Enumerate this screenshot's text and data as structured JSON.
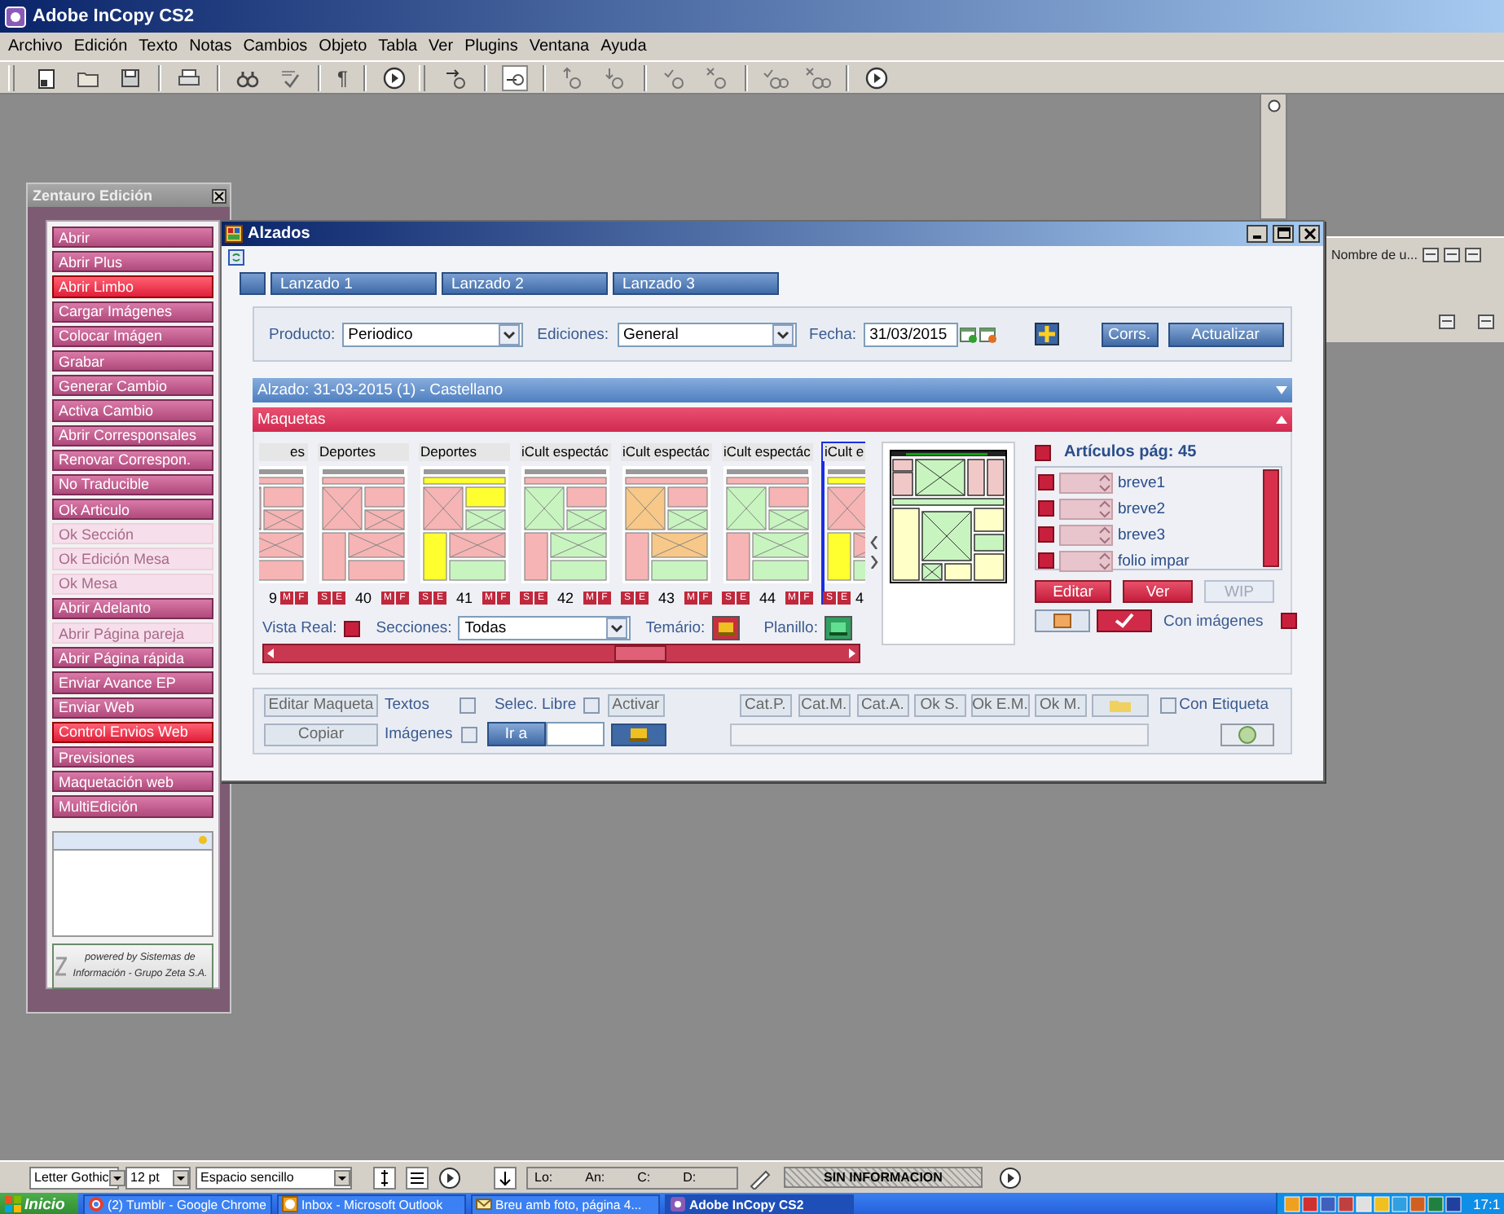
{
  "app": {
    "title": "Adobe InCopy CS2"
  },
  "menu": [
    "Archivo",
    "Edición",
    "Texto",
    "Notas",
    "Cambios",
    "Objeto",
    "Tabla",
    "Ver",
    "Plugins",
    "Ventana",
    "Ayuda"
  ],
  "toolbars": [
    {
      "groups": [
        [
          {
            "kind": "new"
          },
          {
            "kind": "open"
          },
          {
            "kind": "save"
          }
        ],
        [
          {
            "kind": "print"
          }
        ],
        [
          {
            "kind": "find"
          },
          {
            "kind": "spell"
          }
        ],
        [
          {
            "kind": "pilcrow",
            "label": "¶"
          }
        ],
        [
          {
            "kind": "play"
          }
        ]
      ]
    },
    {
      "groups": [
        [
          {
            "kind": "track"
          }
        ],
        [
          {
            "kind": "track-box"
          }
        ],
        [
          {
            "kind": "prev"
          },
          {
            "kind": "next"
          }
        ],
        [
          {
            "kind": "accept"
          },
          {
            "kind": "reject"
          }
        ],
        [
          {
            "kind": "accept-all"
          },
          {
            "kind": "reject-all"
          }
        ],
        [
          {
            "kind": "play"
          }
        ]
      ]
    }
  ],
  "sidepanel": {
    "title": "Zentauro Edición",
    "buttons": [
      {
        "label": "Abrir",
        "highlighted": false,
        "disabled": false
      },
      {
        "label": "Abrir Plus",
        "highlighted": false,
        "disabled": false
      },
      {
        "label": "Abrir Limbo",
        "highlighted": true,
        "disabled": false
      },
      {
        "label": "Cargar Imágenes",
        "highlighted": false,
        "disabled": false
      },
      {
        "label": "Colocar Imágen",
        "highlighted": false,
        "disabled": false
      },
      {
        "label": "Grabar",
        "highlighted": false,
        "disabled": false
      },
      {
        "label": "Generar Cambio",
        "highlighted": false,
        "disabled": false
      },
      {
        "label": "Activa Cambio",
        "highlighted": false,
        "disabled": false
      },
      {
        "label": "Abrir Corresponsales",
        "highlighted": false,
        "disabled": false
      },
      {
        "label": "Renovar Correspon.",
        "highlighted": false,
        "disabled": false
      },
      {
        "label": "No Traducible",
        "highlighted": false,
        "disabled": false
      },
      {
        "label": "Ok Articulo",
        "highlighted": false,
        "disabled": false
      },
      {
        "label": "Ok Sección",
        "highlighted": false,
        "disabled": true
      },
      {
        "label": "Ok Edición Mesa",
        "highlighted": false,
        "disabled": true
      },
      {
        "label": "Ok Mesa",
        "highlighted": false,
        "disabled": true
      },
      {
        "label": "Abrir Adelanto",
        "highlighted": false,
        "disabled": false
      },
      {
        "label": "Abrir Página pareja",
        "highlighted": false,
        "disabled": true
      },
      {
        "label": "Abrir Página rápida",
        "highlighted": false,
        "disabled": false
      },
      {
        "label": "Enviar Avance EP",
        "highlighted": false,
        "disabled": false
      },
      {
        "label": "Enviar Web",
        "highlighted": false,
        "disabled": false
      },
      {
        "label": "Control Envios Web",
        "highlighted": true,
        "disabled": false
      },
      {
        "label": "Previsiones",
        "highlighted": false,
        "disabled": false
      },
      {
        "label": "Maquetación web",
        "highlighted": false,
        "disabled": false
      },
      {
        "label": "MultiEdición",
        "highlighted": false,
        "disabled": false
      }
    ],
    "credit": "powered by Sistemas de Información - Grupo Zeta S.A."
  },
  "rightpanel": {
    "header": "Nombre de u..."
  },
  "alzados": {
    "title": "Alzados",
    "tabs": [
      {
        "label": "Lanzado 1",
        "selected": false
      },
      {
        "label": "Lanzado 2",
        "selected": false
      },
      {
        "label": "Lanzado 3",
        "selected": false
      }
    ],
    "producto": {
      "label": "Producto:",
      "value": "Periodico"
    },
    "ediciones": {
      "label": "Ediciones:",
      "value": "General"
    },
    "fecha": {
      "label": "Fecha:",
      "value": "31/03/2015"
    },
    "buttons": [
      "Corrs.",
      "Actualizar"
    ],
    "alzado_bar": {
      "label": "Alzado: 31-03-2015 (1) - Castellano",
      "expanded": false
    },
    "maquetas_bar": {
      "label": "Maquetas",
      "expanded": true
    },
    "thumbnails": [
      {
        "title": "es",
        "page": "9",
        "right_marks": [
          "M",
          "F"
        ],
        "kind": "pink",
        "selected": false
      },
      {
        "title": "Deportes",
        "page": "40",
        "left_marks": [
          "S",
          "E"
        ],
        "right_marks": [
          "M",
          "F"
        ],
        "kind": "pink",
        "selected": false
      },
      {
        "title": "Deportes",
        "page": "41",
        "left_marks": [
          "S",
          "E"
        ],
        "right_marks": [
          "M",
          "F"
        ],
        "kind": "yellow",
        "selected": false
      },
      {
        "title": "iCult espectác",
        "page": "42",
        "left_marks": [
          "S",
          "E"
        ],
        "right_marks": [
          "M",
          "F"
        ],
        "kind": "green",
        "selected": false
      },
      {
        "title": "iCult espectác",
        "page": "43",
        "left_marks": [
          "S",
          "E"
        ],
        "right_marks": [
          "M",
          "F"
        ],
        "kind": "mixed",
        "selected": false
      },
      {
        "title": "iCult espectác",
        "page": "44",
        "left_marks": [
          "S",
          "E"
        ],
        "right_marks": [
          "M",
          "F"
        ],
        "kind": "green",
        "selected": false
      },
      {
        "title": "iCult e",
        "page": "4",
        "left_marks": [
          "S",
          "E"
        ],
        "kind": "yellow",
        "selected": true
      }
    ],
    "vista_real": {
      "label": "Vista Real:",
      "checked": true
    },
    "secciones": {
      "label": "Secciones:",
      "value": "Todas"
    },
    "temario": {
      "label": "Temário:"
    },
    "planillo": {
      "label": "Planillo:"
    },
    "articles": {
      "title": "Artículos pág: 45",
      "checked": true,
      "items": [
        {
          "name": "breve1",
          "checked": true
        },
        {
          "name": "breve2",
          "checked": true
        },
        {
          "name": "breve3",
          "checked": true
        },
        {
          "name": "folio impar",
          "checked": true
        }
      ]
    },
    "article_buttons": [
      {
        "label": "Editar",
        "disabled": false
      },
      {
        "label": "Ver",
        "disabled": false
      },
      {
        "label": "WIP",
        "disabled": true
      }
    ],
    "con_imagenes": {
      "label": "Con imágenes",
      "checked": true
    },
    "editar_maqueta": "Editar Maqueta",
    "copiar": "Copiar",
    "textos": {
      "label": "Textos",
      "checked": false
    },
    "imagenes": {
      "label": "Imágenes",
      "checked": false
    },
    "selec_libre": {
      "label": "Selec. Libre",
      "checked": false
    },
    "activar": "Activar",
    "ir_a": "Ir a",
    "status_buttons": [
      "Cat.P.",
      "Cat.M.",
      "Cat.A.",
      "Ok S.",
      "Ok E.M.",
      "Ok M."
    ],
    "con_etiqueta": {
      "label": "Con Etiqueta",
      "checked": false
    }
  },
  "statusbar": {
    "font": "Letter Gothic",
    "size": "12 pt",
    "spacing": "Espacio sencillo",
    "fields": [
      "Lo:",
      "An:",
      "C:",
      "D:"
    ],
    "info": "SIN INFORMACION"
  },
  "taskbar": {
    "start": "Inicio",
    "tasks": [
      {
        "label": "(2) Tumblr - Google Chrome",
        "kind": "chrome",
        "selected": false
      },
      {
        "label": "Inbox - Microsoft Outlook",
        "kind": "outlook",
        "selected": false
      },
      {
        "label": "Breu amb foto, página 4...",
        "kind": "mail",
        "selected": false
      },
      {
        "label": "Adobe InCopy CS2",
        "kind": "incopy",
        "selected": true
      }
    ],
    "clock": "17:1"
  }
}
